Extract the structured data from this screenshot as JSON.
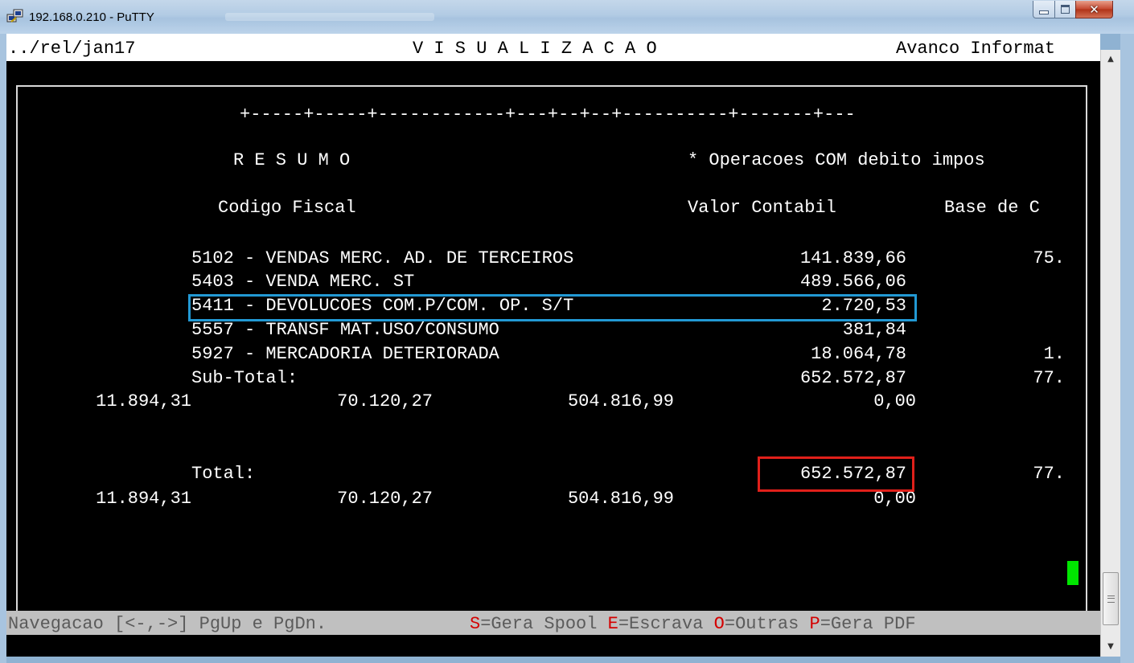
{
  "window": {
    "title": "192.168.0.210 - PuTTY"
  },
  "header": {
    "path": "../rel/jan17",
    "title": "V I S U A L I Z A C A O",
    "company": "Avanco Informat"
  },
  "report": {
    "separator": "+-----+-----+------------+---+--+--+----------+-------+---",
    "resumo_label": "R E S U M O",
    "operations_note": "* Operacoes COM debito impos",
    "col_codigo": "Codigo Fiscal",
    "col_valor": "Valor Contabil",
    "col_base": "Base de C",
    "rows": [
      {
        "desc": "5102 - VENDAS MERC. AD. DE TERCEIROS",
        "valor": "141.839,66",
        "base": "75."
      },
      {
        "desc": "5403 - VENDA MERC. ST",
        "valor": "489.566,06",
        "base": ""
      },
      {
        "desc": "5411 - DEVOLUCOES COM.P/COM. OP. S/T",
        "valor": "2.720,53",
        "base": ""
      },
      {
        "desc": "5557 - TRANSF MAT.USO/CONSUMO",
        "valor": "381,84",
        "base": ""
      },
      {
        "desc": "5927 - MERCADORIA DETERIORADA",
        "valor": "18.064,78",
        "base": "1."
      }
    ],
    "subtotal": {
      "label": "Sub-Total:",
      "valor": "652.572,87",
      "base": "77.",
      "c1": "11.894,31",
      "c2": "70.120,27",
      "c3": "504.816,99",
      "c4": "0,00"
    },
    "total": {
      "label": "Total:",
      "valor": "652.572,87",
      "base": "77.",
      "c1": "11.894,31",
      "c2": "70.120,27",
      "c3": "504.816,99",
      "c4": "0,00"
    }
  },
  "status": {
    "nav": "Navegacao [<-,->] PgUp e PgDn.",
    "items": [
      {
        "key": "S",
        "text": "=Gera Spool"
      },
      {
        "key": "E",
        "text": "=Escrava"
      },
      {
        "key": "O",
        "text": "=Outras"
      },
      {
        "key": "P",
        "text": "=Gera PDF"
      }
    ]
  },
  "colors": {
    "highlight_blue": "#2299d4",
    "highlight_red": "#e0201a",
    "cursor": "#00e600",
    "key_red": "#d40000"
  }
}
